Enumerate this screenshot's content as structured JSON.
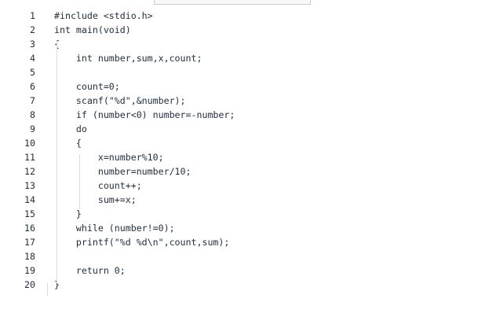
{
  "editor": {
    "lines": [
      {
        "number": "1",
        "code": "#include <stdio.h>"
      },
      {
        "number": "2",
        "code": "int main(void)"
      },
      {
        "number": "3",
        "code": "{"
      },
      {
        "number": "4",
        "code": "    int number,sum,x,count;"
      },
      {
        "number": "5",
        "code": ""
      },
      {
        "number": "6",
        "code": "    count=0;"
      },
      {
        "number": "7",
        "code": "    scanf(\"%d\",&number);"
      },
      {
        "number": "8",
        "code": "    if (number<0) number=-number;"
      },
      {
        "number": "9",
        "code": "    do"
      },
      {
        "number": "10",
        "code": "    {"
      },
      {
        "number": "11",
        "code": "        x=number%10;"
      },
      {
        "number": "12",
        "code": "        number=number/10;"
      },
      {
        "number": "13",
        "code": "        count++;"
      },
      {
        "number": "14",
        "code": "        sum+=x;"
      },
      {
        "number": "15",
        "code": "    }"
      },
      {
        "number": "16",
        "code": "    while (number!=0);"
      },
      {
        "number": "17",
        "code": "    printf(\"%d %d\\n\",count,sum);"
      },
      {
        "number": "18",
        "code": ""
      },
      {
        "number": "19",
        "code": "    return 0;"
      },
      {
        "number": "20",
        "code": "}"
      }
    ]
  }
}
